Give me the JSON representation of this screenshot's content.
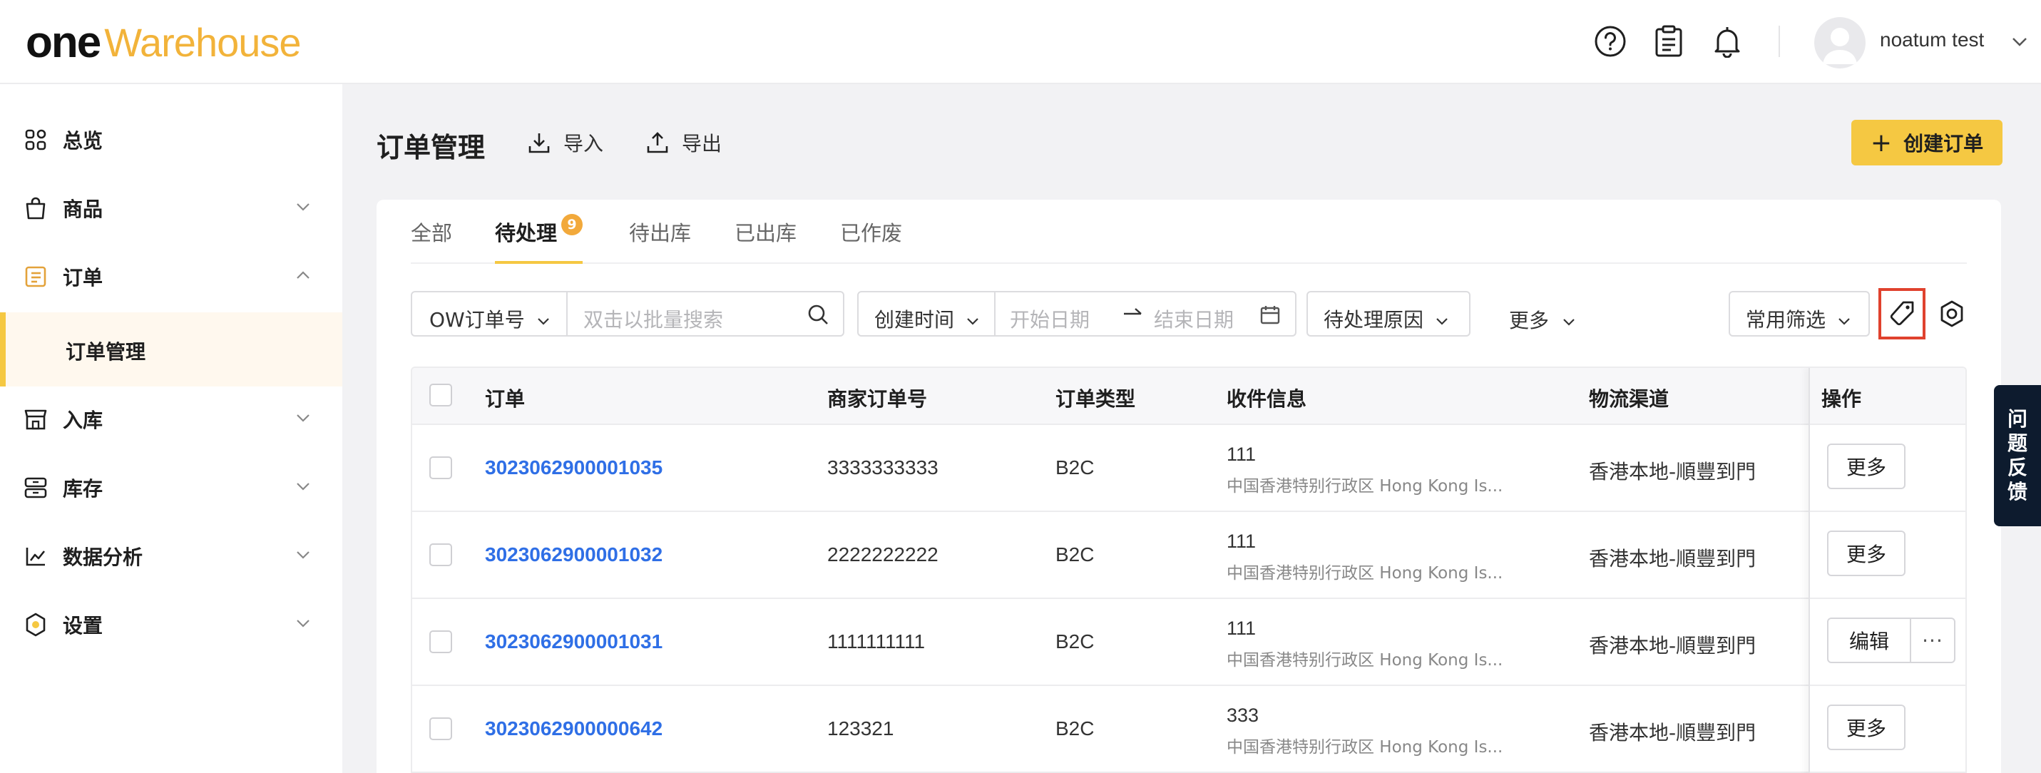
{
  "brand": {
    "logo_one": "one",
    "logo_warehouse": "Warehouse"
  },
  "header": {
    "user_name": "noatum test"
  },
  "sidebar": {
    "items": [
      {
        "label": "总览"
      },
      {
        "label": "商品"
      },
      {
        "label": "订单"
      },
      {
        "label": "订单管理"
      },
      {
        "label": "入库"
      },
      {
        "label": "库存"
      },
      {
        "label": "数据分析"
      },
      {
        "label": "设置"
      }
    ]
  },
  "page": {
    "title": "订单管理",
    "import_label": "导入",
    "export_label": "导出",
    "create_label": "创建订单"
  },
  "tabs": [
    {
      "label": "全部"
    },
    {
      "label": "待处理",
      "badge": "9"
    },
    {
      "label": "待出库"
    },
    {
      "label": "已出库"
    },
    {
      "label": "已作废"
    }
  ],
  "filters": {
    "order_field": "OW订单号",
    "search_placeholder": "双击以批量搜索",
    "time_field": "创建时间",
    "start_placeholder": "开始日期",
    "end_placeholder": "结束日期",
    "reason_field": "待处理原因",
    "more_label": "更多",
    "common_filter": "常用筛选"
  },
  "table": {
    "columns": [
      "订单",
      "商家订单号",
      "订单类型",
      "收件信息",
      "物流渠道",
      "操作"
    ],
    "rows": [
      {
        "order": "3023062900001035",
        "merchant_no": "3333333333",
        "type": "B2C",
        "recipient": "111",
        "address": "中国香港特别行政区 Hong Kong Is...",
        "channel": "香港本地-順豐到門",
        "action": "更多"
      },
      {
        "order": "3023062900001032",
        "merchant_no": "2222222222",
        "type": "B2C",
        "recipient": "111",
        "address": "中国香港特别行政区 Hong Kong Is...",
        "channel": "香港本地-順豐到門",
        "action": "更多"
      },
      {
        "order": "3023062900001031",
        "merchant_no": "1111111111",
        "type": "B2C",
        "recipient": "111",
        "address": "中国香港特别行政区 Hong Kong Is...",
        "channel": "香港本地-順豐到門",
        "action": "编辑",
        "action_more": "···"
      },
      {
        "order": "3023062900000642",
        "merchant_no": "123321",
        "type": "B2C",
        "recipient": "333",
        "address": "中国香港特别行政区 Hong Kong Is...",
        "channel": "香港本地-順豐到門",
        "action": "更多"
      }
    ]
  },
  "feedback": {
    "chars": [
      "问",
      "题",
      "反",
      "馈"
    ]
  },
  "colors": {
    "accent": "#f5c842",
    "link": "#2f6fe6",
    "badge": "#f2a93b",
    "highlight": "#e0422e",
    "feedback_bg": "#0d1b2e"
  },
  "icons": [
    "help-icon",
    "clipboard-icon",
    "bell-icon",
    "chevron-down-icon",
    "import-icon",
    "export-icon",
    "search-icon",
    "calendar-icon",
    "tag-icon",
    "settings-icon"
  ]
}
